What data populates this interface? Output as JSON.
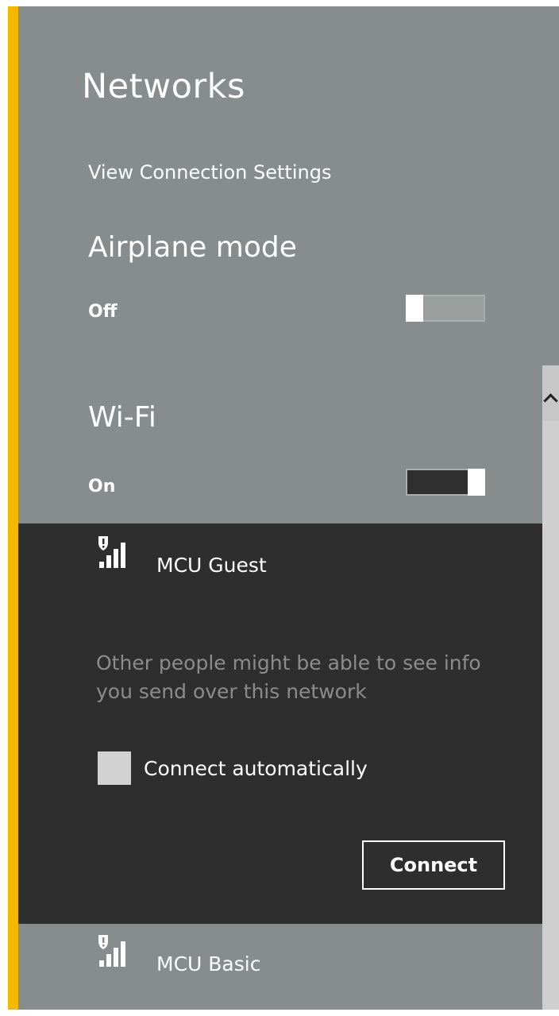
{
  "networks_panel": {
    "title": "Networks",
    "view_settings_label": "View Connection Settings",
    "airplane_mode": {
      "label": "Airplane mode",
      "state": "Off",
      "enabled": false
    },
    "wifi": {
      "label": "Wi-Fi",
      "state": "On",
      "enabled": true
    },
    "networks": [
      {
        "name": "MCU Guest",
        "icon": "secured-warning-wifi-signal-icon",
        "expanded": true,
        "warning": "Other people might be able to see info you send over this network",
        "connect_automatically_label": "Connect automatically",
        "connect_automatically": false,
        "connect_button_label": "Connect"
      },
      {
        "name": "MCU Basic",
        "icon": "secured-warning-wifi-signal-icon",
        "expanded": false
      }
    ]
  },
  "colors": {
    "accent": "#f5b800",
    "panel_background": "#868d8c",
    "expanded_background": "#2e2e2e",
    "text": "#ffffff",
    "muted_text": "#8c8c8c"
  }
}
